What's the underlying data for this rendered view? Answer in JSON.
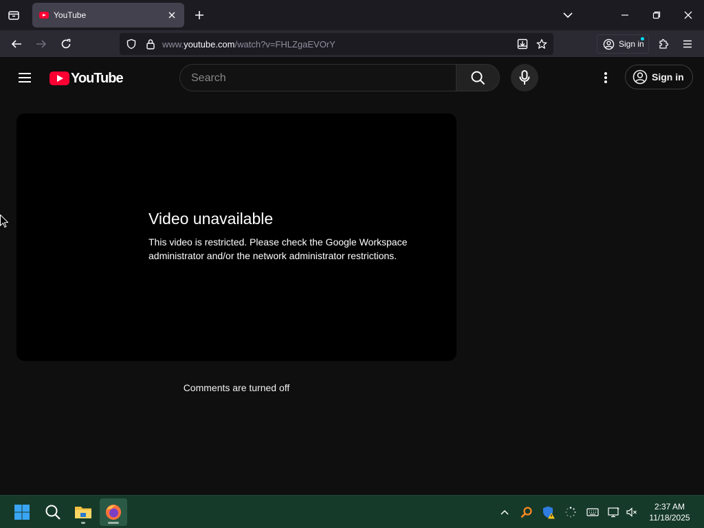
{
  "browser": {
    "tab": {
      "title": "YouTube"
    },
    "url": {
      "prefix": "www.",
      "host": "youtube.com",
      "path": "/watch?v=FHLZgaEVOrY"
    },
    "signin_label": "Sign in"
  },
  "youtube": {
    "logo_text": "YouTube",
    "search_placeholder": "Search",
    "signin_label": "Sign in",
    "error_title": "Video unavailable",
    "error_message": "This video is restricted. Please check the Google Workspace administrator and/or the network administrator restrictions.",
    "comments_status": "Comments are turned off"
  },
  "taskbar": {
    "time": "2:37 AM",
    "date": "11/18/2025"
  },
  "colors": {
    "yt_red": "#ff0033",
    "taskbar_bg": "#163a2a",
    "page_bg": "#0f0f0f"
  }
}
